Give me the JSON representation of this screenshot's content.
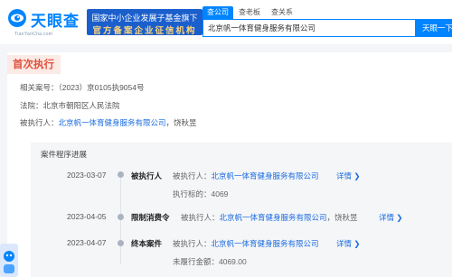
{
  "header": {
    "logo_text": "天眼查",
    "logo_url": "TianYanCha.com",
    "banner_line1": "国家中小企业发展子基金旗下",
    "banner_line2": "官方备案企业征信机构",
    "tabs": [
      "查公司",
      "查老板",
      "查关系"
    ],
    "search_value": "北京帆一体育健身服务有限公司",
    "search_button": "天眼一下"
  },
  "record": {
    "title": "首次执行",
    "case_label": "相关案号：",
    "case_number": "（2023）京0105执9054号",
    "court_label": "法院：",
    "court": "北京市朝阳区人民法院",
    "executed_label": "被执行人：",
    "executed_company": "北京帆一体育健身服务有限公司",
    "executed_person": "，饶秋昱"
  },
  "progress": {
    "title": "案件程序进展",
    "events": [
      {
        "date": "2023-03-07",
        "type": "被执行人",
        "detail_label": "被执行人：",
        "company": "北京帆一体育健身服务有限公司",
        "person": "",
        "more": "详情 ❯",
        "extra": "执行标的：4069"
      },
      {
        "date": "2023-04-05",
        "type": "限制消费令",
        "detail_label": "被执行人：",
        "company": "北京帆一体育健身服务有限公司",
        "person": "，饶秋昱",
        "more": "详情 ❯",
        "extra": ""
      },
      {
        "date": "2023-04-07",
        "type": "终本案件",
        "detail_label": "被执行人：",
        "company": "北京帆一体育健身服务有限公司",
        "person": "",
        "more": "详情 ❯",
        "extra": "未履行金额：4069.00"
      }
    ]
  },
  "colors": {
    "brand": "#0084ff",
    "banner": "#1b5fcd",
    "title_accent": "#e2503a",
    "link": "#1a6be0"
  }
}
